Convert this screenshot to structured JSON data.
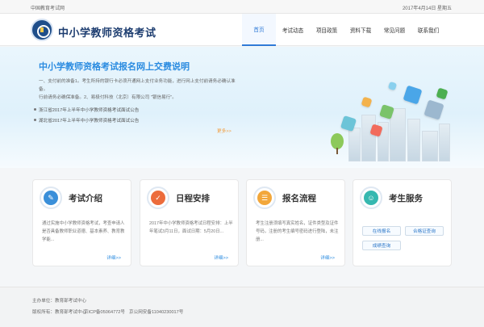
{
  "topbar": {
    "left": "中国教育考试网",
    "right": "2017年4月14日 星期五"
  },
  "header": {
    "title": "中小学教师资格考试"
  },
  "nav": {
    "items": [
      "首页",
      "考试动态",
      "项目政策",
      "资料下载",
      "常见问题",
      "联系我们"
    ]
  },
  "hero": {
    "title": "中小学教师资格考试报名网上交费说明",
    "desc_1": "一、支付前的准备1。考生所持的银行卡必须开通网上支付业务功能，进行网上支付前请务必确认准备。",
    "desc_2": "行前请务必确保准备。2、易极付科技（北京）有限公司 \"银信易行\"。",
    "notices": [
      "浙江省2017年上半年中小学教师资格考试面试公告",
      "湖北省2017年上半年中小学教师资格考试面试公告"
    ],
    "more": "更多>>"
  },
  "cards": [
    {
      "title": "考试介绍",
      "text": "通过实施中小学教师资格考试，考查申请人是否具备教师职业道德、基本素养、教育教学能...",
      "more": "详细>>"
    },
    {
      "title": "日程安排",
      "text": "2017年中小学教师资格考试日程安排：上半年笔试3月11日，面试日期：5月20日...",
      "more": "详细>>"
    },
    {
      "title": "报名流程",
      "text": "考生注册须填写真实姓名，证件类型及证件号码，注册的考生编号密码进行登陆，未注册...",
      "more": "详细>>"
    },
    {
      "title": "考生服务",
      "buttons": [
        "在线报名",
        "合格证查询",
        "成绩查询"
      ]
    }
  ],
  "footer": {
    "sponsor": "主办单位：教育部考试中心",
    "copyright": "版权所有：教育部考试中心",
    "icp": "京ICP备05064772号",
    "beian": "京公网安备11040230017号"
  },
  "colors": {
    "accent": "#2a8be0",
    "brand": "#1d3d70",
    "more": "#f29b3a"
  }
}
